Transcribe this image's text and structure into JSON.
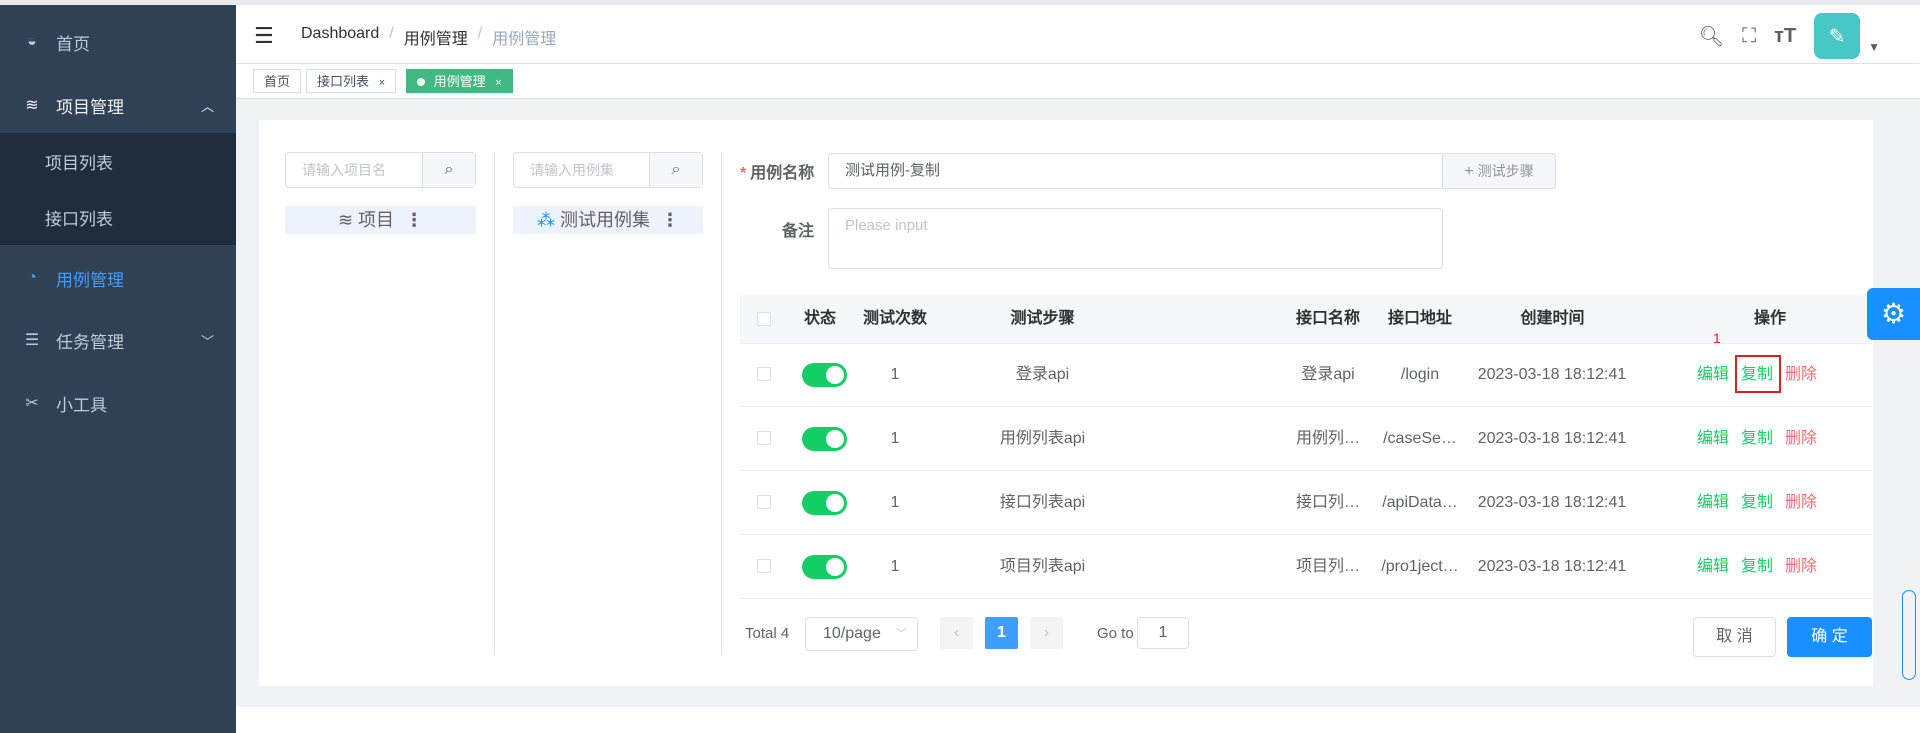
{
  "sidebar": {
    "items": [
      {
        "label": "首页",
        "icon": "dashboard-icon"
      },
      {
        "label": "项目管理",
        "icon": "layers-icon"
      },
      {
        "label": "项目列表"
      },
      {
        "label": "接口列表"
      },
      {
        "label": "用例管理",
        "icon": "gauge-icon"
      },
      {
        "label": "任务管理",
        "icon": "list-icon"
      },
      {
        "label": "小工具",
        "icon": "tools-icon"
      }
    ]
  },
  "navbar": {
    "breadcrumb": [
      "Dashboard",
      "用例管理",
      "用例管理"
    ],
    "sep": "/"
  },
  "tags": [
    {
      "label": "首页"
    },
    {
      "label": "接口列表",
      "close": "×"
    },
    {
      "label": "用例管理",
      "close": "×"
    }
  ],
  "left_panels": {
    "project_search_placeholder": "请输入项目名",
    "project_node": "项目",
    "suite_search_placeholder": "请输入用例集",
    "suite_node": "测试用例集",
    "more": "⋮"
  },
  "form": {
    "name_label": "用例名称",
    "required_mark": "*",
    "name_value": "测试用例-复制",
    "step_button": "测试步骤",
    "remark_label": "备注",
    "remark_placeholder": "Please input"
  },
  "table": {
    "headers": [
      "状态",
      "测试次数",
      "测试步骤",
      "接口名称",
      "接口地址",
      "创建时间",
      "操作"
    ],
    "rows": [
      {
        "count": "1",
        "step": "登录api",
        "api_name": "登录api",
        "api_url": "/login",
        "created": "2023-03-18 18:12:41"
      },
      {
        "count": "1",
        "step": "用例列表api",
        "api_name": "用例列…",
        "api_url": "/caseSe…",
        "created": "2023-03-18 18:12:41"
      },
      {
        "count": "1",
        "step": "接口列表api",
        "api_name": "接口列…",
        "api_url": "/apiData…",
        "created": "2023-03-18 18:12:41"
      },
      {
        "count": "1",
        "step": "项目列表api",
        "api_name": "项目列…",
        "api_url": "/pro1ject…",
        "created": "2023-03-18 18:12:41"
      }
    ],
    "ops": {
      "edit": "编辑",
      "copy": "复制",
      "delete": "删除"
    },
    "annotation": "1"
  },
  "pagination": {
    "total": "Total 4",
    "page_size": "10/page",
    "current": "1",
    "goto_label": "Go to",
    "goto_value": "1"
  },
  "footer": {
    "cancel": "取 消",
    "confirm": "确 定"
  },
  "colors": {
    "sidebar": "#304156",
    "accent": "#1890ff",
    "success": "#13ce66",
    "danger": "#f56c6c",
    "tag_active": "#42b983"
  }
}
